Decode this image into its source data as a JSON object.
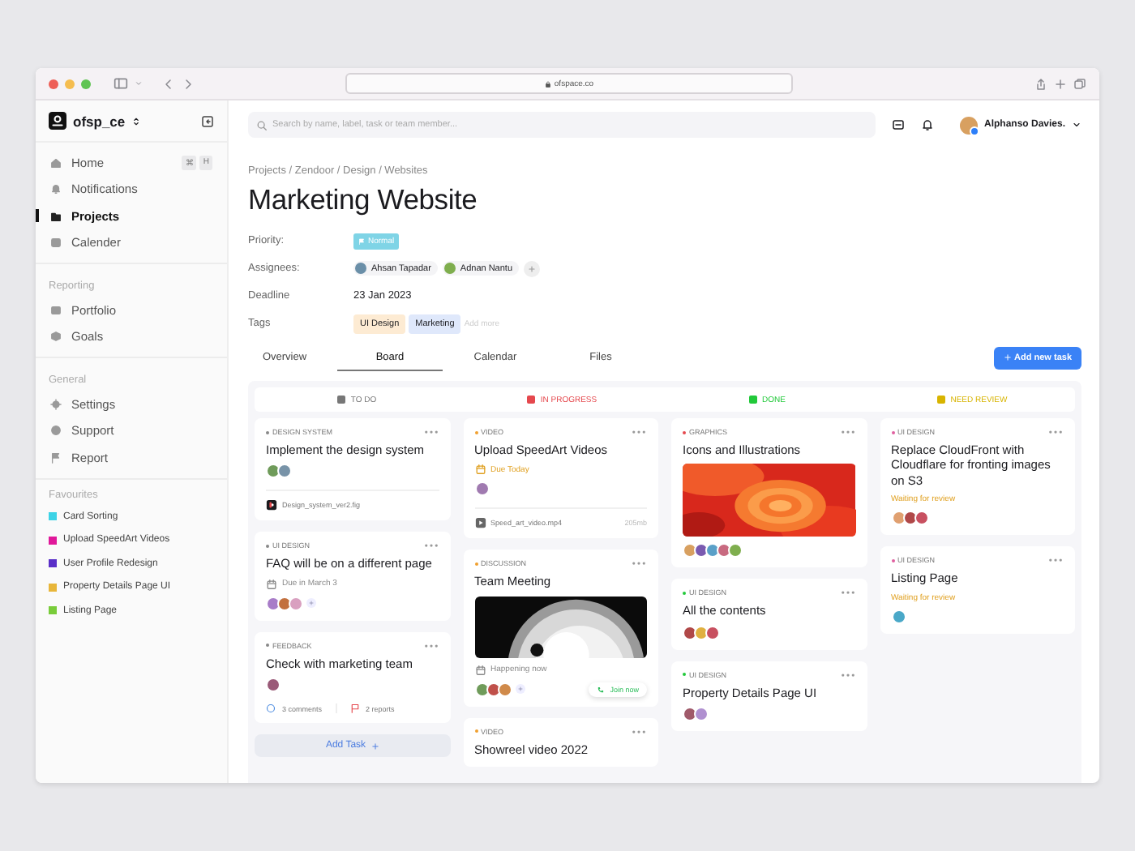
{
  "browser": {
    "url": "ofspace.co"
  },
  "sidebar": {
    "workspace": "ofsp_ce",
    "sections": [
      {
        "items": [
          {
            "label": "Home",
            "selected": false,
            "shortcut": [
              "⌘",
              "H"
            ]
          },
          {
            "label": "Notifications",
            "selected": false
          },
          {
            "label": "Projects",
            "selected": true
          },
          {
            "label": "Calender",
            "selected": false
          }
        ]
      },
      {
        "title": "Reporting",
        "items": [
          {
            "label": "Portfolio",
            "selected": false
          },
          {
            "label": "Goals",
            "selected": false
          }
        ]
      },
      {
        "title": "General",
        "items": [
          {
            "label": "Settings",
            "selected": false
          },
          {
            "label": "Support",
            "selected": false
          },
          {
            "label": "Report",
            "selected": false
          }
        ]
      }
    ],
    "favourites": {
      "title": "Favourites",
      "items": [
        {
          "label": "Card Sorting",
          "color": "#3dd3e6"
        },
        {
          "label": "Upload SpeedArt Videos",
          "color": "#e0189a"
        },
        {
          "label": "User Profile Redesign",
          "color": "#5a2fc8"
        },
        {
          "label": "Property Details Page UI",
          "color": "#e8b63a"
        },
        {
          "label": "Listing Page",
          "color": "#79cc3a"
        }
      ]
    }
  },
  "header": {
    "search": {
      "placeholder": "Search by name, label, task or team member..."
    },
    "user": {
      "name": "Alphanso Davies.",
      "online": true
    }
  },
  "breadcrumb": "Projects / Zendoor / Design / Websites",
  "title": "Marketing Website",
  "details": {
    "priority": {
      "label": "Priority:",
      "value": "Normal"
    },
    "assignees": {
      "label": "Assignees:",
      "people": [
        {
          "name": "Ahsan Tapadar",
          "color": "#6a8fa8"
        },
        {
          "name": "Adnan Nantu",
          "color": "#7fae4e"
        }
      ]
    },
    "deadline": {
      "label": "Deadline",
      "value": "23 Jan 2023"
    },
    "tags": {
      "label": "Tags",
      "items": [
        {
          "label": "UI Design",
          "color": "#fdebd3"
        },
        {
          "label": "Marketing",
          "color": "#dfe8fb"
        }
      ],
      "placeholder": "Add more"
    }
  },
  "tabs": [
    {
      "label": "Overview",
      "selected": false
    },
    {
      "label": "Board",
      "selected": true
    },
    {
      "label": "Calendar",
      "selected": false
    },
    {
      "label": "Files",
      "selected": false
    }
  ],
  "add_task_button": "Add new task",
  "columns": [
    {
      "title": "TO DO",
      "color": "#777777",
      "cards": [
        {
          "category": "DESIGN SYSTEM",
          "color": "#888888",
          "title": "Implement the design system",
          "avatars": [
            {
              "color": "#6f9b5a"
            },
            {
              "color": "#7893a8"
            }
          ],
          "attachment": {
            "kind": "figma",
            "name": "Design_system_ver2.fig"
          }
        },
        {
          "category": "UI DESIGN",
          "color": "#888888",
          "title": "FAQ will be on a different page",
          "due": {
            "text": "Due in March 3",
            "urgent": false
          },
          "avatars": [
            {
              "color": "#a87cc8"
            },
            {
              "color": "#c2703e"
            },
            {
              "color": "#d9a0c0"
            }
          ],
          "add_member": true
        },
        {
          "category": "FEEDBACK",
          "color": "#888888",
          "title": "Check with marketing team",
          "avatars": [
            {
              "color": "#9a5a78"
            }
          ],
          "footer": {
            "comments": "3 comments",
            "reports": "2 reports"
          }
        }
      ],
      "add_button": "Add Task"
    },
    {
      "title": "IN PROGRESS",
      "color": "#e5484d",
      "cards": [
        {
          "category": "VIDEO",
          "color": "#f0a030",
          "title": "Upload SpeedArt Videos",
          "due": {
            "text": "Due Today",
            "urgent": true
          },
          "avatars": [
            {
              "color": "#a07ab0"
            }
          ],
          "attachment": {
            "kind": "video",
            "name": "Speed_art_video.mp4",
            "size": "205mb"
          }
        },
        {
          "category": "DISCUSSION",
          "color": "#f0a030",
          "title": "Team Meeting",
          "image": {
            "kind": "picture"
          },
          "due": {
            "text": "Happening now",
            "urgent": false
          },
          "avatars": [
            {
              "color": "#6f9b5a"
            },
            {
              "color": "#c0504a"
            },
            {
              "color": "#d08a4a"
            }
          ],
          "add_member": true,
          "action": "Join now"
        },
        {
          "category": "VIDEO",
          "color": "#f0a030",
          "title": "Showreel video 2022"
        }
      ]
    },
    {
      "title": "DONE",
      "color": "#22c93a",
      "cards": [
        {
          "category": "GRAPHICS",
          "color": "#e5484d",
          "title": "Icons and Illustrations",
          "image": {
            "kind": "picture"
          },
          "avatars": [
            {
              "color": "#d8a060"
            },
            {
              "color": "#7a5ab0"
            },
            {
              "color": "#5aa0c8"
            },
            {
              "color": "#c86a80"
            },
            {
              "color": "#7fae4e"
            }
          ]
        },
        {
          "category": "UI DESIGN",
          "color": "#22c93a",
          "title": "All the contents",
          "avatars": [
            {
              "color": "#b04848"
            },
            {
              "color": "#e0b040"
            },
            {
              "color": "#c85060"
            }
          ]
        },
        {
          "category": "UI DESIGN",
          "color": "#22c93a",
          "title": "Property Details Page UI",
          "avatars": [
            {
              "color": "#a05a6a"
            },
            {
              "color": "#b090d0"
            }
          ]
        }
      ]
    },
    {
      "title": "NEED REVIEW",
      "color": "#d8b400",
      "cards": [
        {
          "category": "UI DESIGN",
          "color": "#e060a0",
          "title": "Replace CloudFront with Cloudflare for fronting images on S3",
          "status": "Waiting for review",
          "avatars": [
            {
              "color": "#e0a070"
            },
            {
              "color": "#b04848"
            },
            {
              "color": "#c85060"
            }
          ]
        },
        {
          "category": "UI DESIGN",
          "color": "#e060a0",
          "title": "Listing Page",
          "status": "Waiting for review",
          "avatars": [
            {
              "color": "#4aa8c8"
            }
          ]
        }
      ]
    }
  ]
}
